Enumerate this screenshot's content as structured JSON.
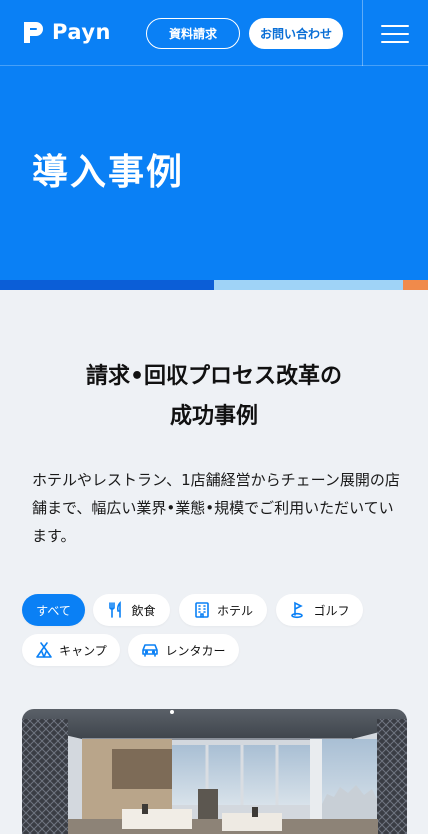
{
  "header": {
    "logo_text": "Payn",
    "request_docs_label": "資料請求",
    "contact_label": "お問い合わせ"
  },
  "hero": {
    "title": "導入事例"
  },
  "section": {
    "title_line1": "請求•回収プロセス改革の",
    "title_line2": "成功事例",
    "description": "ホテルやレストラン、1店舗経営からチェーン展開の店舗まで、幅広い業界•業態•規模でご利用いただいています。"
  },
  "filters": [
    {
      "label": "すべて",
      "icon": "",
      "active": true
    },
    {
      "label": "飲食",
      "icon": "fork-knife-icon",
      "active": false
    },
    {
      "label": "ホテル",
      "icon": "building-icon",
      "active": false
    },
    {
      "label": "ゴルフ",
      "icon": "golf-icon",
      "active": false
    },
    {
      "label": "キャンプ",
      "icon": "tent-icon",
      "active": false
    },
    {
      "label": "レンタカー",
      "icon": "car-icon",
      "active": false
    }
  ],
  "colors": {
    "brand": "#0A80F5",
    "stripe_dark": "#0B5ED7",
    "stripe_light": "#9FD3F7",
    "stripe_accent": "#F08A4B",
    "background": "#EEF1F5"
  }
}
